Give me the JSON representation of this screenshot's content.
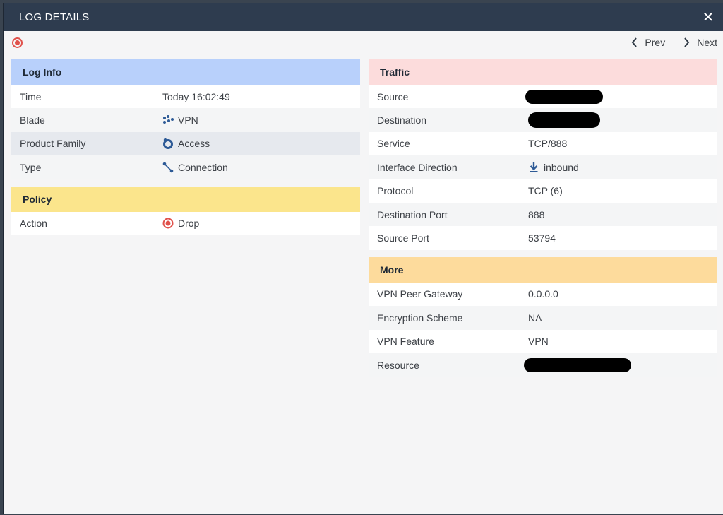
{
  "window": {
    "title": "LOG DETAILS",
    "close_glyph": "✕"
  },
  "toolbar": {
    "prev_label": "Prev",
    "next_label": "Next"
  },
  "log_info": {
    "header": "Log Info",
    "rows": [
      {
        "label": "Time",
        "value": "Today 16:02:49"
      },
      {
        "label": "Blade",
        "value": "VPN",
        "icon": "vpn-icon"
      },
      {
        "label": "Product Family",
        "value": "Access",
        "icon": "access-icon"
      },
      {
        "label": "Type",
        "value": "Connection",
        "icon": "connection-icon"
      }
    ]
  },
  "policy": {
    "header": "Policy",
    "rows": [
      {
        "label": "Action",
        "value": "Drop",
        "icon": "drop-icon"
      }
    ]
  },
  "traffic": {
    "header": "Traffic",
    "rows": [
      {
        "label": "Source",
        "value": "",
        "redacted": true
      },
      {
        "label": "Destination",
        "value": "",
        "redacted": true
      },
      {
        "label": "Service",
        "value": "TCP/888"
      },
      {
        "label": "Interface Direction",
        "value": "inbound",
        "icon": "download-arrow-icon"
      },
      {
        "label": "Protocol",
        "value": "TCP (6)"
      },
      {
        "label": "Destination Port",
        "value": "888"
      },
      {
        "label": "Source Port",
        "value": "53794"
      }
    ]
  },
  "more": {
    "header": "More",
    "rows": [
      {
        "label": "VPN Peer Gateway",
        "value": "0.0.0.0"
      },
      {
        "label": "Encryption Scheme",
        "value": "NA"
      },
      {
        "label": "VPN Feature",
        "value": "VPN"
      },
      {
        "label": "Resource",
        "value": "",
        "redacted": true
      }
    ]
  },
  "colors": {
    "titlebar": "#2e3c4f",
    "log_info_header": "#b8d0fb",
    "policy_header": "#fbe58c",
    "traffic_header": "#fcdcdc",
    "more_header": "#fddb9c",
    "drop_red": "#e0514b",
    "icon_blue": "#2d5a96"
  }
}
